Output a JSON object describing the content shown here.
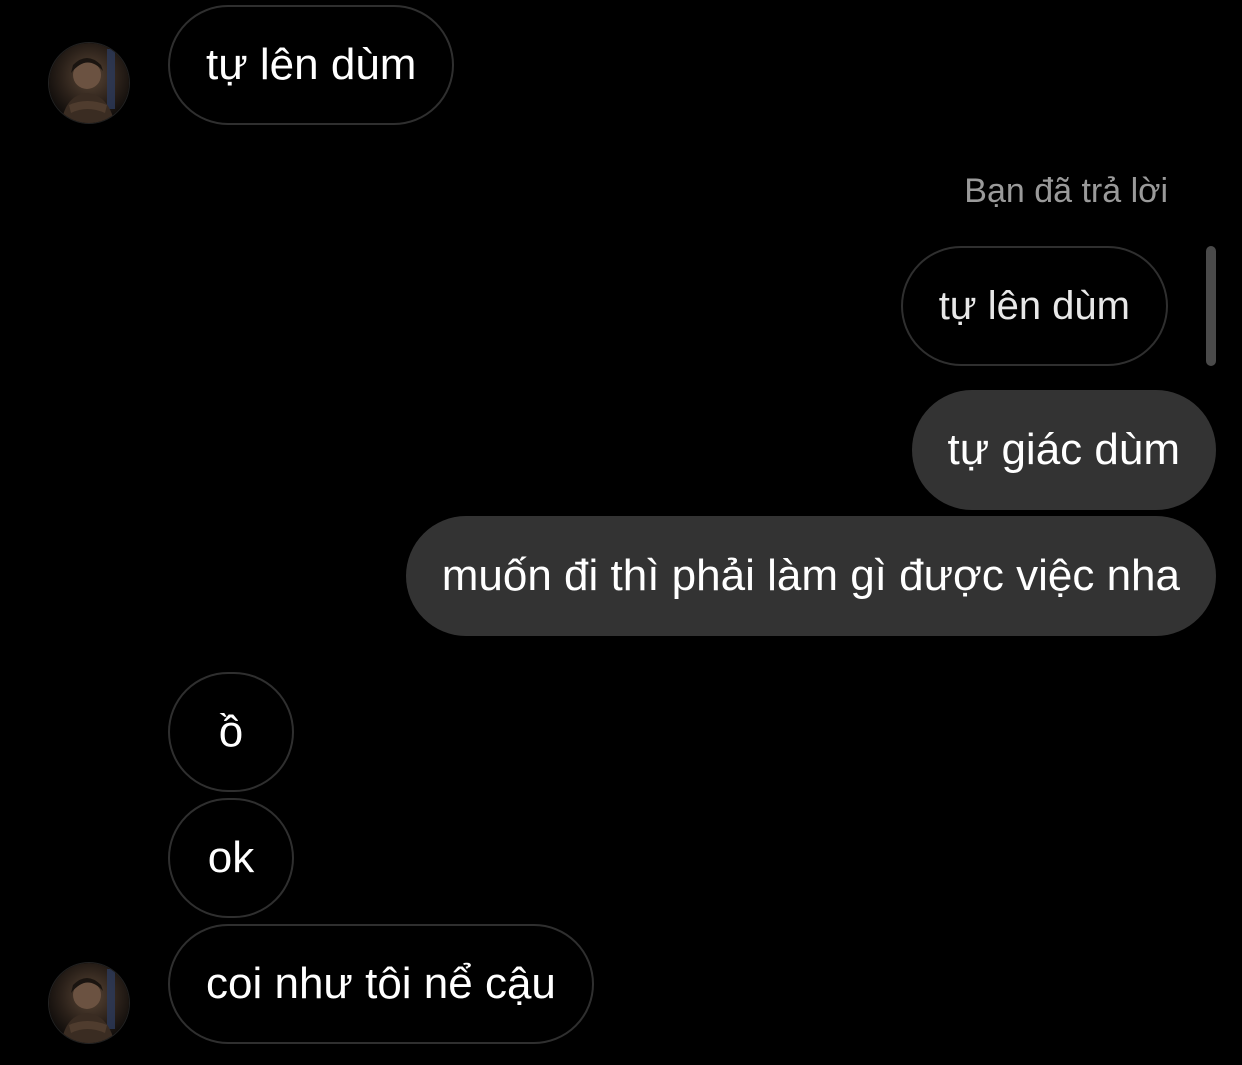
{
  "thread": {
    "reply_label": "Bạn đã trả lời",
    "messages": [
      {
        "id": "m1",
        "sender": "other",
        "text": "tự lên dùm"
      },
      {
        "id": "m2",
        "sender": "me",
        "type": "quoted_reply",
        "text": "tự lên dùm"
      },
      {
        "id": "m3",
        "sender": "me",
        "text": "tự giác dùm"
      },
      {
        "id": "m4",
        "sender": "me",
        "text": "muốn đi thì phải làm gì được việc nha"
      },
      {
        "id": "m5",
        "sender": "other",
        "text": "ồ"
      },
      {
        "id": "m6",
        "sender": "other",
        "text": "ok"
      },
      {
        "id": "m7",
        "sender": "other",
        "text": "coi như tôi nể cậu"
      }
    ]
  },
  "colors": {
    "background": "#000000",
    "outgoing_bubble": "#333333",
    "incoming_border": "#2f2f2f",
    "text": "#ffffff",
    "secondary_text": "#9a9a9a"
  },
  "icons": {
    "avatar": "profile-photo"
  }
}
